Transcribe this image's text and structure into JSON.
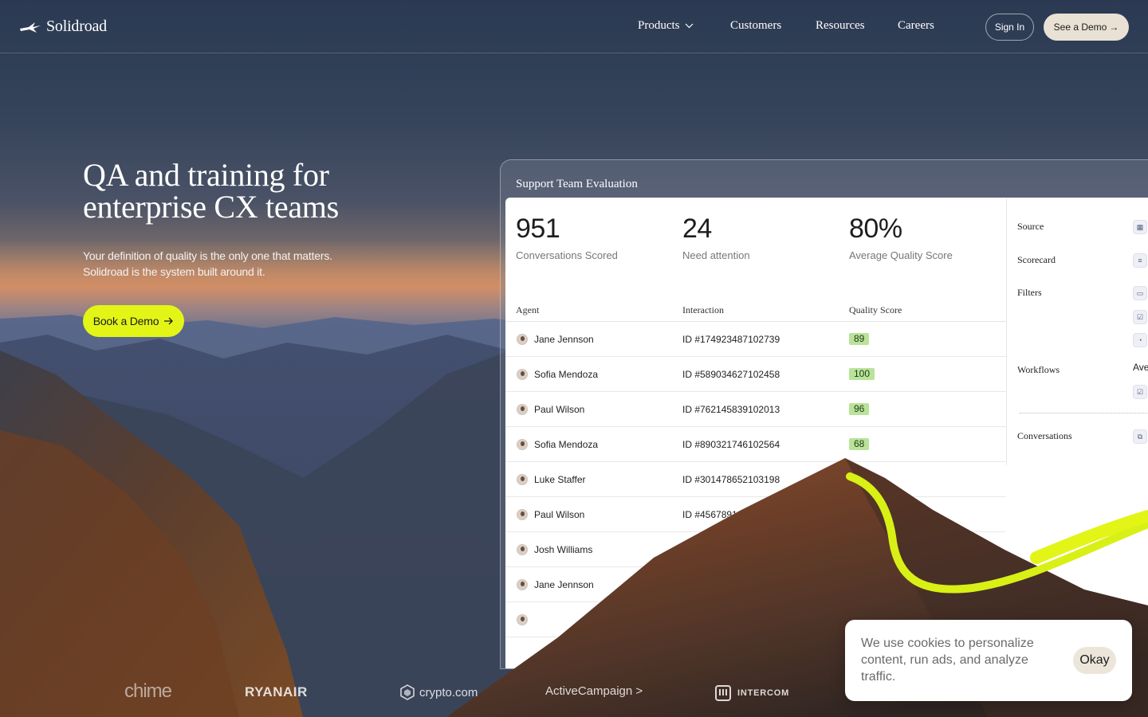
{
  "header": {
    "brand": "Solidroad",
    "nav": {
      "products": "Products",
      "customers": "Customers",
      "resources": "Resources",
      "careers": "Careers"
    },
    "sign_in": "Sign In",
    "see_demo": "See a Demo"
  },
  "hero": {
    "title_line1": "QA and training for",
    "title_line2": "enterprise CX teams",
    "sub_line1": "Your definition of quality is the only one that matters.",
    "sub_line2": "Solidroad is the system built around it.",
    "cta": "Book a Demo"
  },
  "panel": {
    "title": "Support Team Evaluation",
    "stats": [
      {
        "value": "951",
        "label": "Conversations Scored"
      },
      {
        "value": "24",
        "label": "Need attention"
      },
      {
        "value": "80%",
        "label": "Average Quality Score"
      }
    ],
    "columns": {
      "agent": "Agent",
      "interaction": "Interaction",
      "quality": "Quality Score"
    },
    "rows": [
      {
        "agent": "Jane Jennson",
        "interaction": "ID #174923487102739",
        "score": "89"
      },
      {
        "agent": "Sofia Mendoza",
        "interaction": "ID #589034627102458",
        "score": "100"
      },
      {
        "agent": "Paul Wilson",
        "interaction": "ID #762145839102013",
        "score": "96"
      },
      {
        "agent": "Sofia Mendoza",
        "interaction": "ID #890321746102564",
        "score": "68"
      },
      {
        "agent": "Luke Staffer",
        "interaction": "ID #301478652103198",
        "score": ""
      },
      {
        "agent": "Paul Wilson",
        "interaction": "ID #45678912",
        "score": ""
      },
      {
        "agent": "Josh Williams",
        "interaction": "",
        "score": ""
      },
      {
        "agent": "Jane Jennson",
        "interaction": "",
        "score": ""
      }
    ],
    "sidebar": {
      "source": "Source",
      "scorecard": "Scorecard",
      "filters": "Filters",
      "workflows": "Workflows",
      "workflows_extra": "Ave",
      "conversations": "Conversations"
    }
  },
  "logos": {
    "chime": "chime",
    "ryanair": "RYANAIR",
    "crypto": "crypto.com",
    "activecampaign": "ActiveCampaign >",
    "intercom": "INTERCOM"
  },
  "cookie": {
    "text": "We use cookies to personalize content, run ads, and analyze traffic.",
    "button": "Okay"
  },
  "colors": {
    "accent": "#e2f516",
    "score_badge": "#b9e39a",
    "cream": "#e9e1d3"
  }
}
